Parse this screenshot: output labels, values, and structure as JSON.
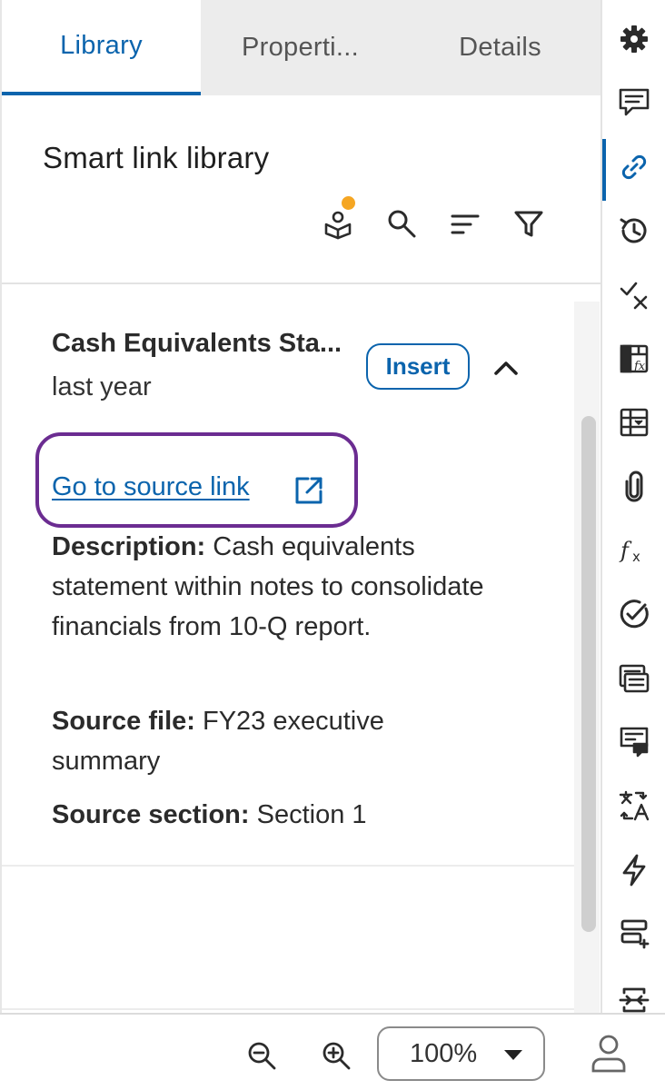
{
  "tabs": [
    {
      "label": "Library",
      "active": true
    },
    {
      "label": "Properti...",
      "active": false
    },
    {
      "label": "Details",
      "active": false
    }
  ],
  "library": {
    "title": "Smart link library",
    "toolbar_icons": [
      "library-notification-icon",
      "search-icon",
      "sort-icon",
      "filter-icon"
    ]
  },
  "item": {
    "title": "Cash Equivalents Sta...",
    "subtitle": "last year",
    "insert_label": "Insert",
    "source_link_label": "Go to source link",
    "description_label": "Description:",
    "description_text": " Cash equivalents statement within notes to consolidate financials from 10-Q report.",
    "source_file_label": "Source file:",
    "source_file_text": " FY23 executive summary",
    "source_section_label": "Source section:",
    "source_section_text": " Section 1"
  },
  "rail_icons": [
    "gear-icon",
    "comments-icon",
    "link-icon",
    "history-icon",
    "check-cross-icon",
    "table-formula-icon",
    "table-dropdown-icon",
    "paperclip-icon",
    "formula-icon",
    "check-circle-icon",
    "list-card-icon",
    "comment-doc-icon",
    "translate-icon",
    "lightning-icon",
    "insert-row-icon",
    "fit-width-icon"
  ],
  "bottombar": {
    "zoom_value": "100%"
  },
  "colors": {
    "accent": "#0b64ad",
    "highlight": "#6b2c91",
    "notify": "#f5a623"
  }
}
